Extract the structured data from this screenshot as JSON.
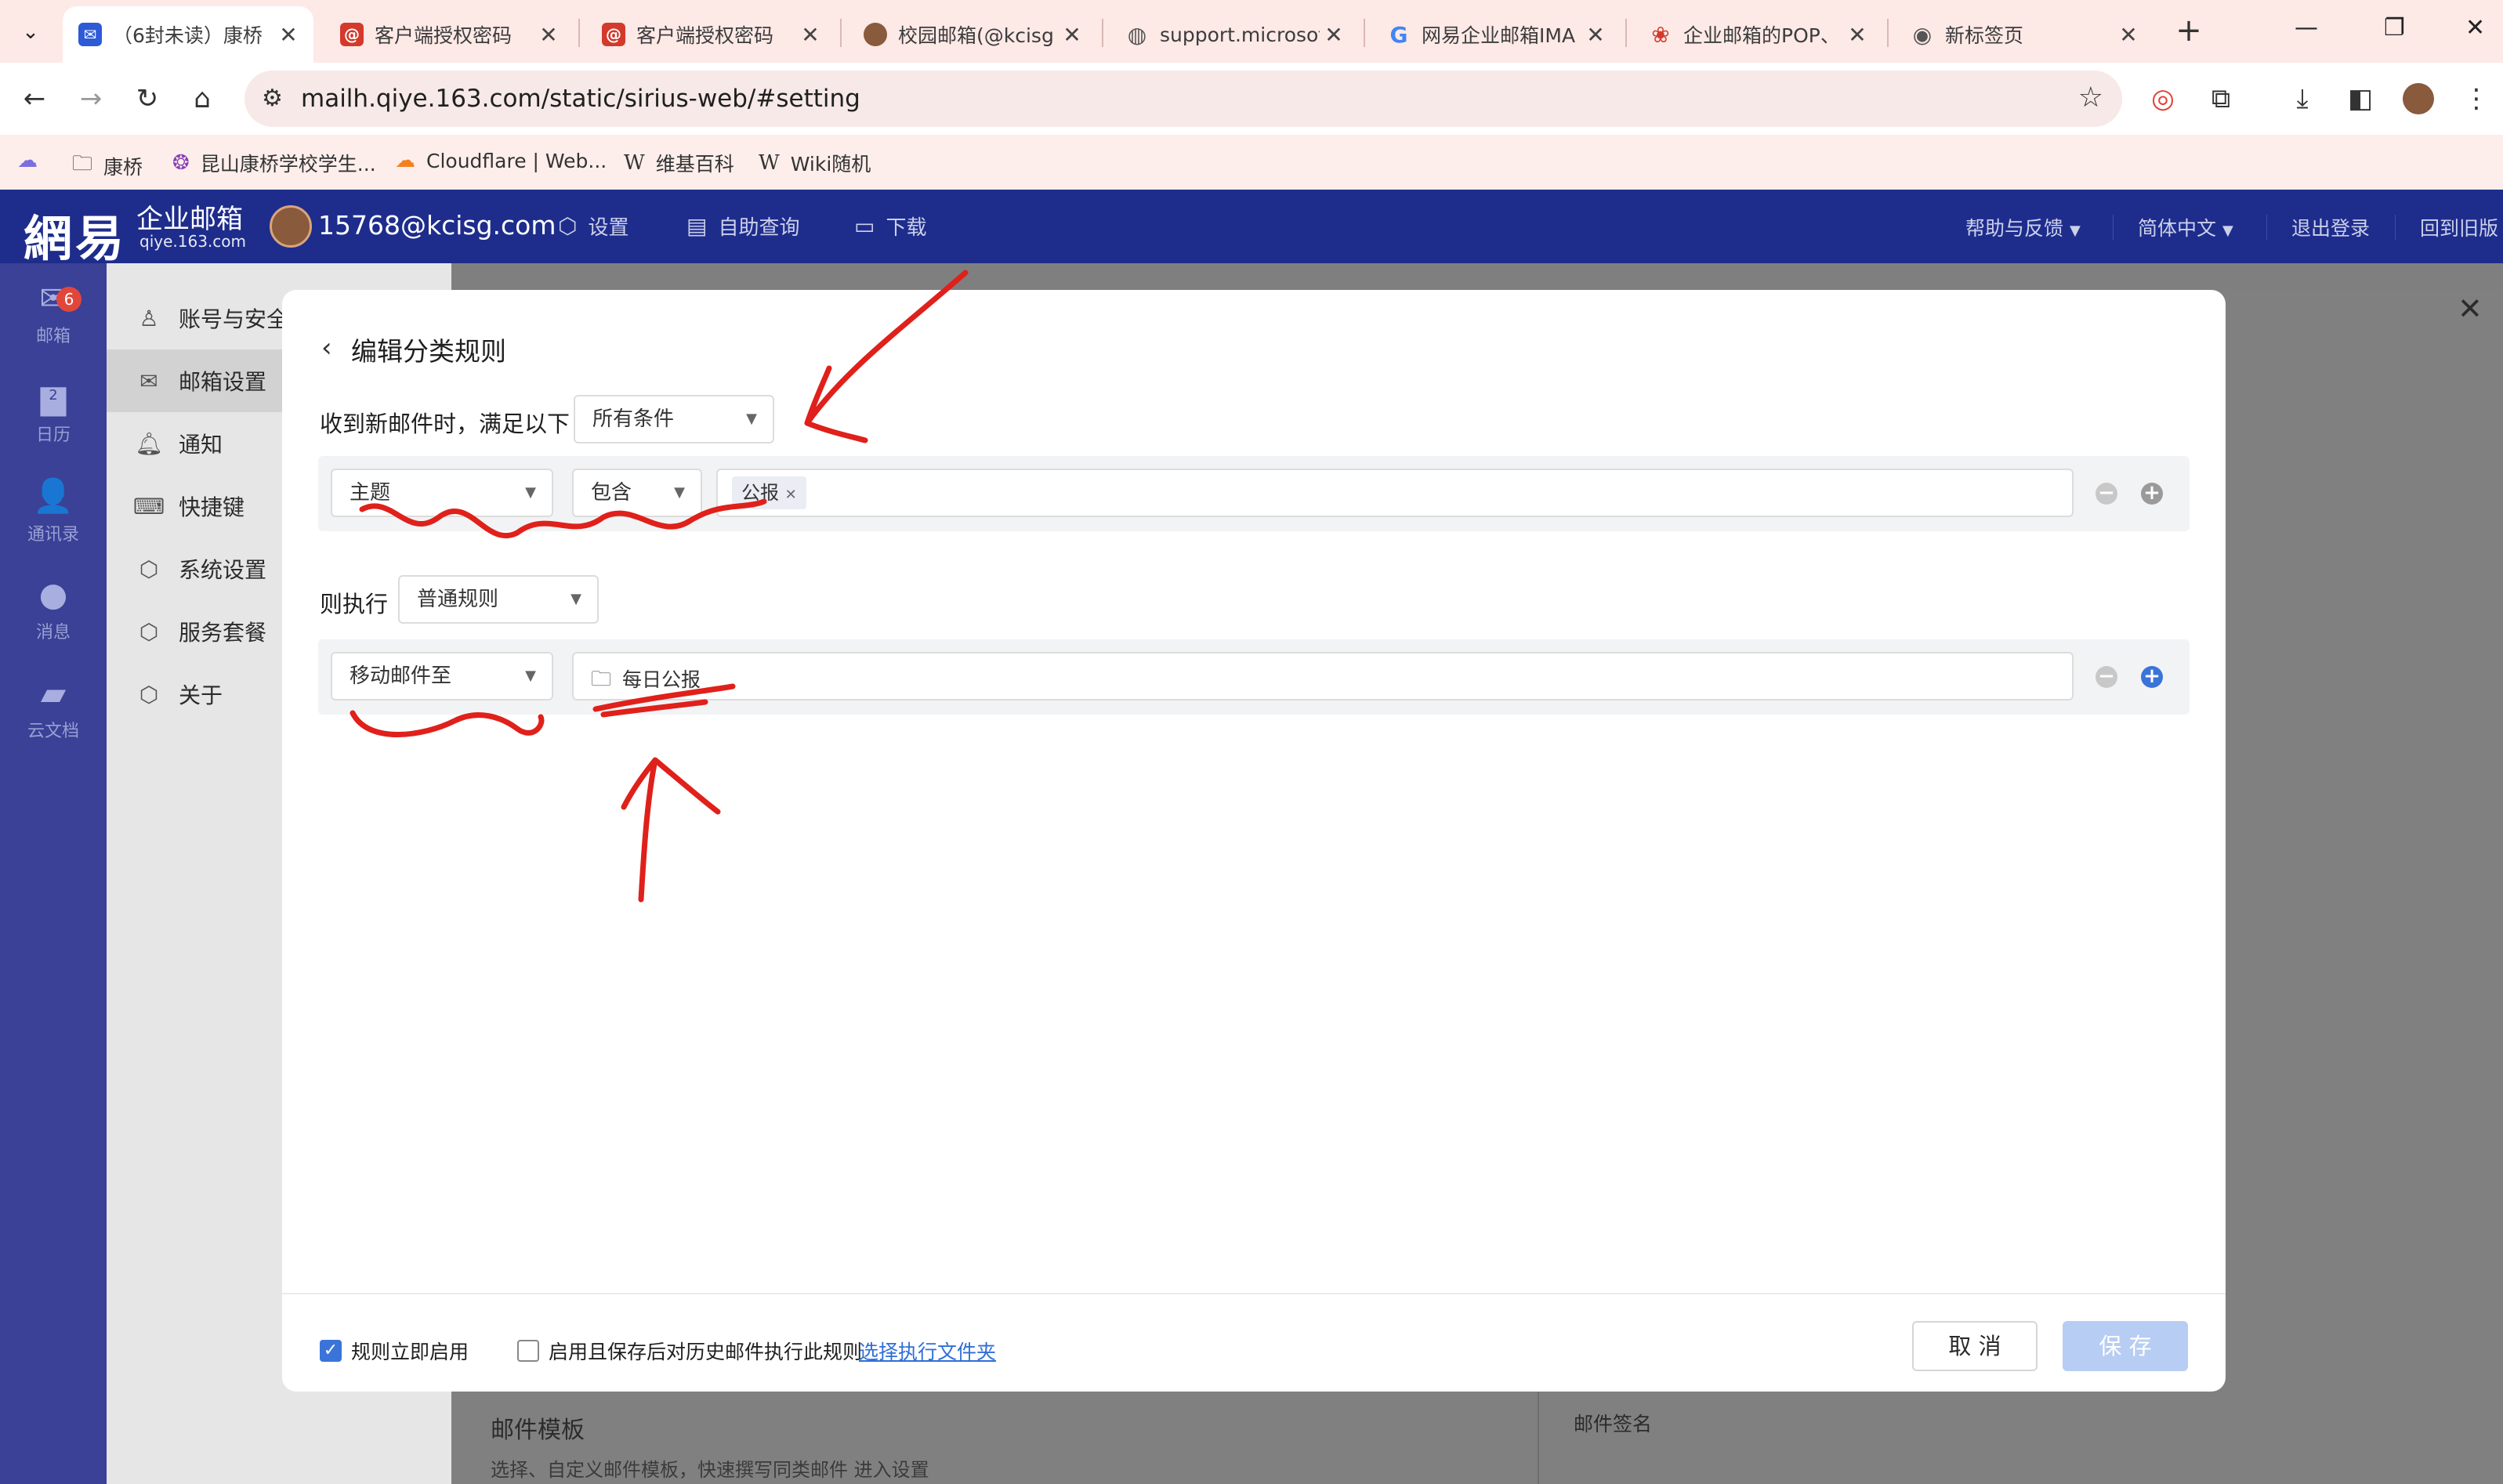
{
  "browser": {
    "tabs": [
      {
        "title": "（6封未读）康桥",
        "favicon": "mail-app-icon",
        "color": "#2d5bd7"
      },
      {
        "title": "客户端授权密码",
        "favicon": "netease-mail-icon",
        "color": "#d33a2c"
      },
      {
        "title": "客户端授权密码",
        "favicon": "netease-mail-icon",
        "color": "#d33a2c"
      },
      {
        "title": "校园邮箱(@kcisg",
        "favicon": "avatar-icon",
        "color": "#8a5a3c"
      },
      {
        "title": "support.microsof",
        "favicon": "globe-icon",
        "color": "#555555"
      },
      {
        "title": "网易企业邮箱IMA",
        "favicon": "google-icon",
        "color": "#4285f4"
      },
      {
        "title": "企业邮箱的POP、",
        "favicon": "netease-icon",
        "color": "#d33a2c"
      },
      {
        "title": "新标签页",
        "favicon": "chrome-icon",
        "color": "#555555"
      }
    ],
    "url": "mailh.qiye.163.com/static/sirius-web/#setting",
    "bookmarks": [
      {
        "label": "",
        "icon": "cloud-icon"
      },
      {
        "label": "康桥",
        "icon": "folder-icon"
      },
      {
        "label": "昆山康桥学校学生...",
        "icon": "school-icon"
      },
      {
        "label": "Cloudflare | Web...",
        "icon": "cloudflare-icon"
      },
      {
        "label": "维基百科",
        "icon": "wikipedia-icon"
      },
      {
        "label": "Wiki随机",
        "icon": "wikipedia-icon"
      }
    ]
  },
  "header": {
    "logo_main": "網易",
    "logo_sub1": "企业邮箱",
    "logo_sub2": "qiye.163.com",
    "email": "15768@kcisg.com",
    "nav": [
      {
        "label": "设置",
        "icon": "settings-hex-icon"
      },
      {
        "label": "自助查询",
        "icon": "document-search-icon"
      },
      {
        "label": "下载",
        "icon": "download-monitor-icon"
      }
    ],
    "right": {
      "help": "帮助与反馈",
      "lang": "简体中文",
      "logout": "退出登录",
      "old_version": "回到旧版"
    }
  },
  "rail": {
    "items": [
      {
        "label": "邮箱",
        "icon": "mail-icon",
        "badge": "6"
      },
      {
        "label": "日历",
        "icon": "calendar-icon",
        "day": "2"
      },
      {
        "label": "通讯录",
        "icon": "contacts-icon"
      },
      {
        "label": "消息",
        "icon": "message-icon"
      },
      {
        "label": "云文档",
        "icon": "cloud-doc-icon"
      }
    ]
  },
  "sidebar": {
    "items": [
      {
        "label": "账号与安全",
        "icon": "user-icon"
      },
      {
        "label": "邮箱设置",
        "icon": "mail-icon",
        "active": true
      },
      {
        "label": "通知",
        "icon": "bell-icon"
      },
      {
        "label": "快捷键",
        "icon": "keyboard-icon"
      },
      {
        "label": "系统设置",
        "icon": "settings-hex-icon"
      },
      {
        "label": "服务套餐",
        "icon": "settings-hex-icon"
      },
      {
        "label": "关于",
        "icon": "settings-hex-icon"
      }
    ]
  },
  "background": {
    "template_title": "邮件模板",
    "template_desc": "选择、自定义邮件模板，快速撰写同类邮件 进入设置",
    "signature_title": "邮件签名"
  },
  "modal": {
    "title": "编辑分类规则",
    "condition_label": "收到新邮件时，满足以下",
    "condition_mode": "所有条件",
    "condition": {
      "field": "主题",
      "operator": "包含",
      "tag": "公报"
    },
    "action_label": "则执行",
    "action_mode": "普通规则",
    "action": {
      "type": "移动邮件至",
      "folder": "每日公报"
    },
    "footer": {
      "enable_now": "规则立即启用",
      "enable_now_checked": true,
      "apply_history": "启用且保存后对历史邮件执行此规则",
      "apply_history_checked": false,
      "choose_folder": "选择执行文件夹",
      "cancel": "取 消",
      "save": "保 存"
    }
  },
  "colors": {
    "header_bg": "#1e2d8c",
    "rail_bg": "#3a4196",
    "accent": "#3b74d8",
    "annotation": "#e0201a"
  }
}
